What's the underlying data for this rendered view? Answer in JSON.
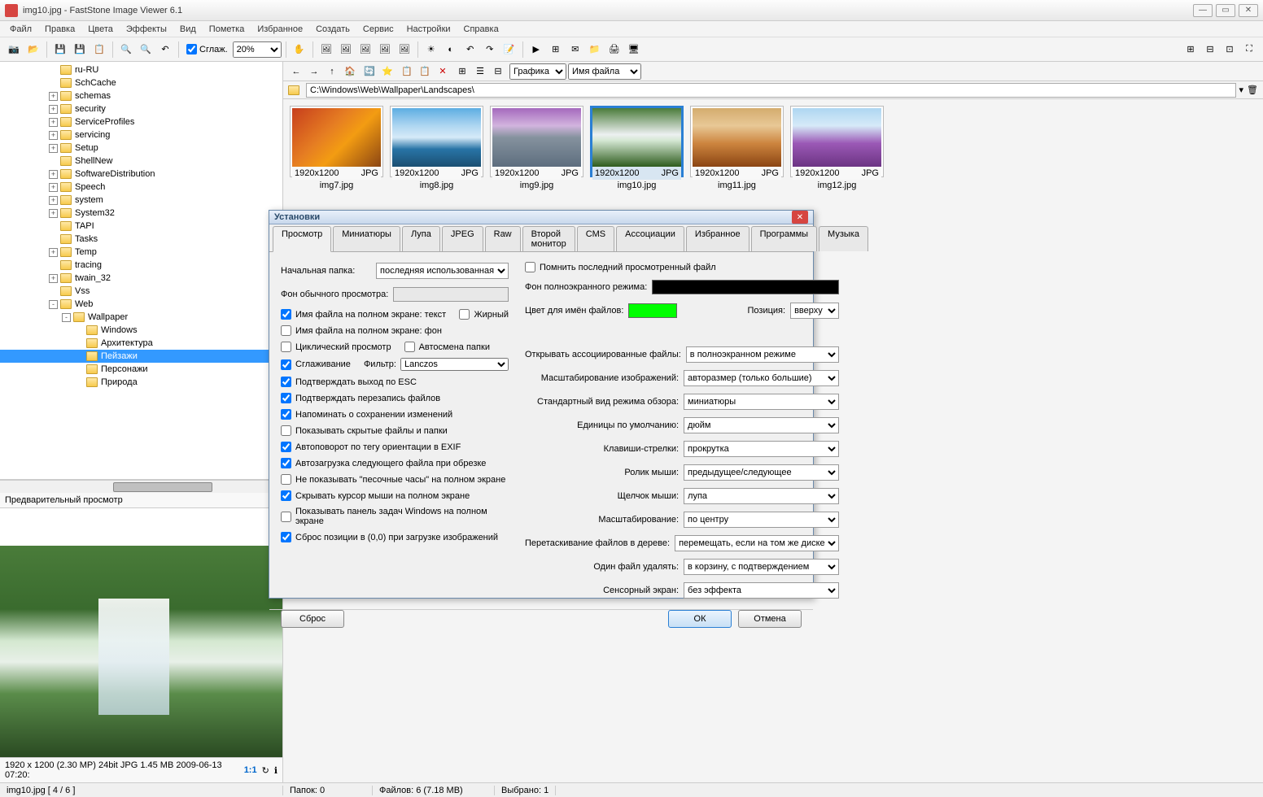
{
  "window": {
    "title": "img10.jpg  -  FastStone Image Viewer 6.1"
  },
  "menu": [
    "Файл",
    "Правка",
    "Цвета",
    "Эффекты",
    "Вид",
    "Пометка",
    "Избранное",
    "Создать",
    "Сервис",
    "Настройки",
    "Справка"
  ],
  "toolbar": {
    "smoothing_label": "Сглаж.",
    "zoom": "20%"
  },
  "nav": {
    "view_label": "Графика",
    "sort_label": "Имя файла"
  },
  "path": "C:\\Windows\\Web\\Wallpaper\\Landscapes\\",
  "tree": [
    {
      "name": "ru-RU",
      "level": 0,
      "exp": ""
    },
    {
      "name": "SchCache",
      "level": 0,
      "exp": ""
    },
    {
      "name": "schemas",
      "level": 0,
      "exp": "+"
    },
    {
      "name": "security",
      "level": 0,
      "exp": "+"
    },
    {
      "name": "ServiceProfiles",
      "level": 0,
      "exp": "+"
    },
    {
      "name": "servicing",
      "level": 0,
      "exp": "+"
    },
    {
      "name": "Setup",
      "level": 0,
      "exp": "+"
    },
    {
      "name": "ShellNew",
      "level": 0,
      "exp": ""
    },
    {
      "name": "SoftwareDistribution",
      "level": 0,
      "exp": "+"
    },
    {
      "name": "Speech",
      "level": 0,
      "exp": "+"
    },
    {
      "name": "system",
      "level": 0,
      "exp": "+"
    },
    {
      "name": "System32",
      "level": 0,
      "exp": "+"
    },
    {
      "name": "TAPI",
      "level": 0,
      "exp": ""
    },
    {
      "name": "Tasks",
      "level": 0,
      "exp": ""
    },
    {
      "name": "Temp",
      "level": 0,
      "exp": "+"
    },
    {
      "name": "tracing",
      "level": 0,
      "exp": ""
    },
    {
      "name": "twain_32",
      "level": 0,
      "exp": "+"
    },
    {
      "name": "Vss",
      "level": 0,
      "exp": ""
    },
    {
      "name": "Web",
      "level": 0,
      "exp": "-"
    },
    {
      "name": "Wallpaper",
      "level": 1,
      "exp": "-"
    },
    {
      "name": "Windows",
      "level": 2,
      "exp": ""
    },
    {
      "name": "Архитектура",
      "level": 2,
      "exp": ""
    },
    {
      "name": "Пейзажи",
      "level": 2,
      "exp": "",
      "selected": true
    },
    {
      "name": "Персонажи",
      "level": 2,
      "exp": ""
    },
    {
      "name": "Природа",
      "level": 2,
      "exp": ""
    }
  ],
  "preview": {
    "header": "Предварительный просмотр",
    "info": "1920 x 1200 (2.30 MP)  24bit  JPG   1.45 MB   2009-06-13 07:20:",
    "ratio": "1:1"
  },
  "thumbs": [
    {
      "name": "img7.jpg",
      "dim": "1920x1200",
      "type": "JPG",
      "pic": "pic7"
    },
    {
      "name": "img8.jpg",
      "dim": "1920x1200",
      "type": "JPG",
      "pic": "pic8"
    },
    {
      "name": "img9.jpg",
      "dim": "1920x1200",
      "type": "JPG",
      "pic": "pic9"
    },
    {
      "name": "img10.jpg",
      "dim": "1920x1200",
      "type": "JPG",
      "pic": "pic10",
      "selected": true
    },
    {
      "name": "img11.jpg",
      "dim": "1920x1200",
      "type": "JPG",
      "pic": "pic11"
    },
    {
      "name": "img12.jpg",
      "dim": "1920x1200",
      "type": "JPG",
      "pic": "pic12"
    }
  ],
  "status": {
    "file_index": "img10.jpg  [ 4 / 6 ]",
    "folders": "Папок: 0",
    "files": "Файлов: 6 (7.18 MB)",
    "selected": "Выбрано: 1"
  },
  "dialog": {
    "title": "Установки",
    "tabs": [
      "Просмотр",
      "Миниатюры",
      "Лупа",
      "JPEG",
      "Raw",
      "Второй монитор",
      "CMS",
      "Ассоциации",
      "Избранное",
      "Программы",
      "Музыка"
    ],
    "left": {
      "start_folder_label": "Начальная папка:",
      "start_folder_value": "последняя использованная",
      "bg_normal_label": "Фон обычного просмотра:",
      "filename_fullscreen_text": "Имя файла на полном экране: текст",
      "bold": "Жирный",
      "filename_fullscreen_bg": "Имя файла на полном экране: фон",
      "cyclic": "Циклический просмотр",
      "autofolder": "Автосмена папки",
      "smoothing": "Сглаживание",
      "filter_label": "Фильтр:",
      "filter_value": "Lanczos",
      "confirm_esc": "Подтверждать выход по ESC",
      "confirm_overwrite": "Подтверждать перезапись файлов",
      "remind_save": "Напоминать о сохранении изменений",
      "show_hidden": "Показывать скрытые файлы и папки",
      "autorotate": "Автоповорот по тегу ориентации в EXIF",
      "autoload": "Автозагрузка следующего файла при обрезке",
      "no_hourglass": "Не показывать \"песочные часы\" на полном экране",
      "hide_cursor": "Скрывать курсор мыши на полном экране",
      "show_taskbar": "Показывать панель задач Windows на полном экране",
      "reset_pos": "Сброс позиции в (0,0) при загрузке изображений"
    },
    "right": {
      "remember_last": "Помнить последний просмотренный файл",
      "bg_fullscreen_label": "Фон полноэкранного режима:",
      "color_filenames_label": "Цвет для имён файлов:",
      "position_label": "Позиция:",
      "position_value": "вверху",
      "open_assoc_label": "Открывать ассоциированные файлы:",
      "open_assoc_value": "в полноэкранном режиме",
      "scaling_label": "Масштабирование изображений:",
      "scaling_value": "авторазмер (только большие)",
      "default_view_label": "Стандартный вид режима обзора:",
      "default_view_value": "миниатюры",
      "units_label": "Единицы по умолчанию:",
      "units_value": "дюйм",
      "arrows_label": "Клавиши-стрелки:",
      "arrows_value": "прокрутка",
      "wheel_label": "Ролик мыши:",
      "wheel_value": "предыдущее/следующее",
      "click_label": "Щелчок мыши:",
      "click_value": "лупа",
      "zoom_label": "Масштабирование:",
      "zoom_value": "по центру",
      "drag_label": "Перетаскивание файлов в дереве:",
      "drag_value": "перемещать, если на том же диске",
      "delete_label": "Один файл удалять:",
      "delete_value": "в корзину, с подтверждением",
      "touch_label": "Сенсорный экран:",
      "touch_value": "без эффекта"
    },
    "buttons": {
      "reset": "Сброс",
      "ok": "ОК",
      "cancel": "Отмена"
    },
    "colors": {
      "bg_fullscreen": "#000000",
      "filename_color": "#00ff00"
    }
  }
}
